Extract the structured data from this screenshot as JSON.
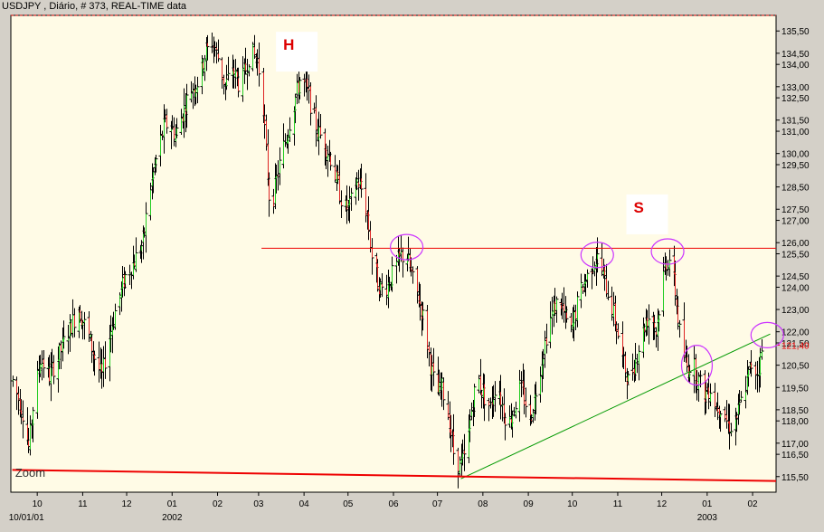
{
  "chart_data": {
    "type": "bar",
    "style": "ohlc",
    "title": "USDJPY , Diário, # 373, REAL-TIME data",
    "xlabel": "",
    "ylabel": "",
    "ylim": [
      114.8,
      136.2
    ],
    "y_ticks": [
      "135,50",
      "134,50",
      "134,00",
      "133,00",
      "132,50",
      "131,50",
      "131,00",
      "130,00",
      "129,50",
      "128,50",
      "127,50",
      "127,00",
      "126,00",
      "125,50",
      "124,50",
      "124,00",
      "123,00",
      "122,00",
      "121,50",
      "120,50",
      "119,50",
      "118,50",
      "118,00",
      "117,00",
      "116,50",
      "115,50"
    ],
    "last_price": "121,40",
    "x_ticks": [
      {
        "label": "10",
        "year": "10/01/01",
        "day": 0
      },
      {
        "label": "11",
        "year": "",
        "day": 31
      },
      {
        "label": "12",
        "year": "",
        "day": 61
      },
      {
        "label": "01",
        "year": "2002",
        "day": 92
      },
      {
        "label": "02",
        "year": "",
        "day": 123
      },
      {
        "label": "03",
        "year": "",
        "day": 151
      },
      {
        "label": "04",
        "year": "",
        "day": 182
      },
      {
        "label": "05",
        "year": "",
        "day": 212
      },
      {
        "label": "06",
        "year": "",
        "day": 243
      },
      {
        "label": "07",
        "year": "",
        "day": 273
      },
      {
        "label": "08",
        "year": "",
        "day": 304
      },
      {
        "label": "09",
        "year": "",
        "day": 335
      },
      {
        "label": "10",
        "year": "",
        "day": 365
      },
      {
        "label": "11",
        "year": "",
        "day": 396
      },
      {
        "label": "12",
        "year": "",
        "day": 426
      },
      {
        "label": "01",
        "year": "2003",
        "day": 457
      },
      {
        "label": "02",
        "year": "",
        "day": 488
      }
    ],
    "x_range_days": [
      -18,
      504
    ],
    "price_path": [
      [
        -17,
        119.8
      ],
      [
        -10,
        118.4
      ],
      [
        -6,
        116.8
      ],
      [
        -3,
        118.6
      ],
      [
        2,
        120.8
      ],
      [
        8,
        120.0
      ],
      [
        15,
        121.0
      ],
      [
        22,
        122.2
      ],
      [
        28,
        123.0
      ],
      [
        34,
        122.0
      ],
      [
        40,
        120.6
      ],
      [
        44,
        120.0
      ],
      [
        48,
        121.5
      ],
      [
        54,
        123.2
      ],
      [
        60,
        124.5
      ],
      [
        66,
        125.2
      ],
      [
        72,
        126.0
      ],
      [
        76,
        128.2
      ],
      [
        82,
        130.0
      ],
      [
        86,
        131.2
      ],
      [
        90,
        131.4
      ],
      [
        94,
        130.8
      ],
      [
        99,
        131.8
      ],
      [
        104,
        132.8
      ],
      [
        110,
        133.3
      ],
      [
        114,
        134.4
      ],
      [
        119,
        135.0
      ],
      [
        123,
        134.3
      ],
      [
        128,
        133.0
      ],
      [
        133,
        133.8
      ],
      [
        138,
        133.0
      ],
      [
        142,
        133.8
      ],
      [
        145,
        134.6
      ],
      [
        149,
        134.3
      ],
      [
        153,
        133.2
      ],
      [
        156,
        130.0
      ],
      [
        159,
        127.2
      ],
      [
        162,
        128.5
      ],
      [
        166,
        129.8
      ],
      [
        170,
        130.8
      ],
      [
        174,
        132.0
      ],
      [
        179,
        133.3
      ],
      [
        183,
        133.0
      ],
      [
        187,
        132.0
      ],
      [
        191,
        131.0
      ],
      [
        195,
        130.6
      ],
      [
        200,
        129.8
      ],
      [
        205,
        128.5
      ],
      [
        209,
        127.5
      ],
      [
        213,
        127.6
      ],
      [
        218,
        128.8
      ],
      [
        221,
        128.4
      ],
      [
        225,
        127.2
      ],
      [
        228,
        125.4
      ],
      [
        232,
        124.2
      ],
      [
        236,
        123.8
      ],
      [
        240,
        124.3
      ],
      [
        244,
        124.8
      ],
      [
        248,
        125.4
      ],
      [
        252,
        125.4
      ],
      [
        256,
        124.3
      ],
      [
        260,
        123.5
      ],
      [
        264,
        122.4
      ],
      [
        268,
        120.5
      ],
      [
        272,
        119.2
      ],
      [
        276,
        119.5
      ],
      [
        280,
        118.3
      ],
      [
        284,
        116.6
      ],
      [
        288,
        116.0
      ],
      [
        292,
        116.4
      ],
      [
        296,
        118.5
      ],
      [
        300,
        120.0
      ],
      [
        304,
        119.2
      ],
      [
        309,
        118.6
      ],
      [
        313,
        119.8
      ],
      [
        317,
        118.7
      ],
      [
        321,
        117.8
      ],
      [
        325,
        118.6
      ],
      [
        329,
        119.5
      ],
      [
        333,
        118.8
      ],
      [
        336,
        118.0
      ],
      [
        340,
        119.4
      ],
      [
        344,
        120.8
      ],
      [
        348,
        122.2
      ],
      [
        352,
        123.0
      ],
      [
        356,
        123.5
      ],
      [
        360,
        122.6
      ],
      [
        364,
        122.0
      ],
      [
        368,
        123.2
      ],
      [
        372,
        124.1
      ],
      [
        376,
        124.6
      ],
      [
        379,
        125.2
      ],
      [
        383,
        125.3
      ],
      [
        387,
        124.2
      ],
      [
        391,
        123.4
      ],
      [
        395,
        122.2
      ],
      [
        399,
        120.8
      ],
      [
        403,
        119.8
      ],
      [
        407,
        120.5
      ],
      [
        411,
        121.6
      ],
      [
        415,
        122.5
      ],
      [
        419,
        122.8
      ],
      [
        422,
        122.0
      ],
      [
        425,
        123.6
      ],
      [
        428,
        125.0
      ],
      [
        431,
        125.3
      ],
      [
        435,
        123.8
      ],
      [
        439,
        121.4
      ],
      [
        443,
        120.4
      ],
      [
        447,
        120.6
      ],
      [
        451,
        119.8
      ],
      [
        455,
        119.2
      ],
      [
        459,
        119.5
      ],
      [
        463,
        118.6
      ],
      [
        467,
        118.7
      ],
      [
        471,
        117.8
      ],
      [
        475,
        117.8
      ],
      [
        479,
        118.6
      ],
      [
        483,
        119.6
      ],
      [
        487,
        120.5
      ],
      [
        491,
        120.2
      ],
      [
        495,
        121.4
      ]
    ],
    "lines": [
      {
        "name": "neckline",
        "color": "#ee0000",
        "points": [
          [
            153,
            125.75
          ],
          [
            504,
            125.75
          ]
        ]
      },
      {
        "name": "trendline",
        "color": "#009900",
        "points": [
          [
            289,
            115.4
          ],
          [
            500,
            121.9
          ]
        ]
      },
      {
        "name": "base",
        "color": "#ee0000",
        "points": [
          [
            -17,
            115.8
          ],
          [
            504,
            115.3
          ]
        ]
      }
    ],
    "circles": [
      {
        "day": 252,
        "price": 125.8
      },
      {
        "day": 382,
        "price": 125.45
      },
      {
        "day": 430,
        "price": 125.6
      },
      {
        "day": 450,
        "price": 120.5
      },
      {
        "day": 498,
        "price": 121.85
      }
    ],
    "annotations": [
      {
        "text": "H",
        "day": 153,
        "price": 135.3,
        "color": "#dd0000"
      },
      {
        "text": "S",
        "day": 392,
        "price": 128.0,
        "color": "#dd0000"
      },
      {
        "text": "Zoom",
        "day": -15,
        "price": 115.7,
        "color": "#333333"
      }
    ],
    "colors": {
      "background": "#fffbe6",
      "frame": "#d4d0c8",
      "bar_up": "#22cc22",
      "bar_down": "#dd2222",
      "bar_neutral": "#000000",
      "circle": "#cc33ff",
      "last_price_label": "#ee0000"
    },
    "grid": false,
    "legend": "none"
  }
}
